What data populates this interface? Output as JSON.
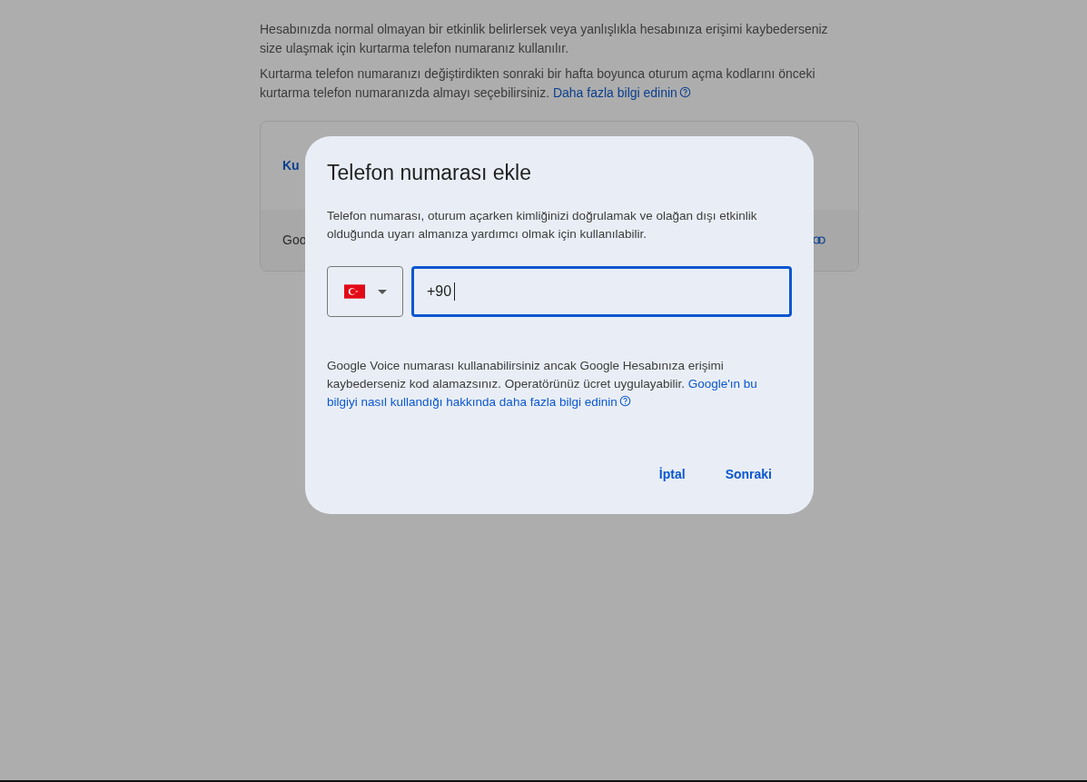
{
  "page": {
    "paragraphs": [
      {
        "text": "Hesabınızda normal olmayan bir etkinlik belirlersek veya yanlışlıkla hesabınıza erişimi kaybederseniz size ulaşmak için kurtarma telefon numaranız kullanılır."
      },
      {
        "text": "Kurtarma telefon numaranızı değiştirdikten sonraki bir hafta boyunca oturum açma kodlarını önceki kurtarma telefon numaranızda almayı seçebilirsiniz.",
        "link": "Daha fazla bilgi edinin"
      }
    ],
    "card": {
      "link": "Ku",
      "row_text": "Goo"
    }
  },
  "dialog": {
    "title": "Telefon numarası ekle",
    "description": "Telefon numarası, oturum açarken kimliğinizi doğrulamak ve olağan dışı etkinlik olduğunda uyarı almanıza yardımcı olmak için kullanılabilir.",
    "phone": {
      "value": "+90",
      "focused": true
    },
    "note": "Google Voice numarası kullanabilirsiniz ancak Google Hesabınıza erişimi kaybederseniz kod alamazsınız. Operatörünüz ücret uygulayabilir.",
    "note_links": [
      "Google'ın bu",
      "bilgiyi nasıl kullandığı hakkında daha fazla bilgi edinin"
    ],
    "buttons": [
      "İptal",
      "Sonraki"
    ]
  }
}
